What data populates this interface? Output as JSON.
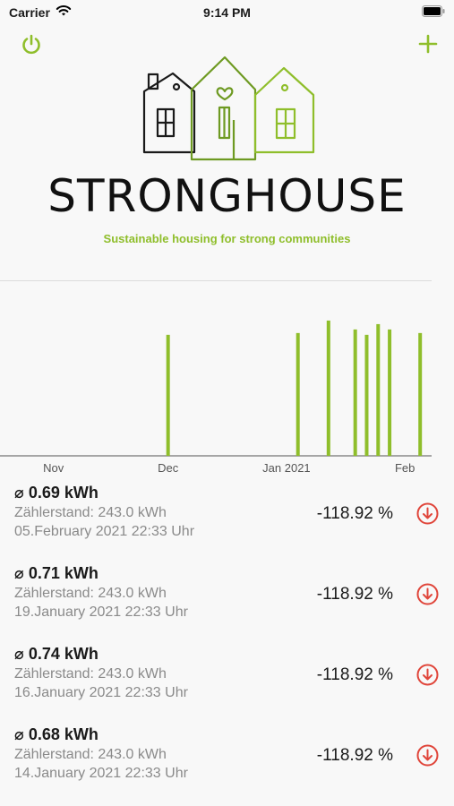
{
  "status_bar": {
    "carrier": "Carrier",
    "time": "9:14 PM"
  },
  "header": {
    "power_icon": "power-icon",
    "add_icon": "plus-icon"
  },
  "brand": {
    "name": "STRONGHOUSE",
    "tagline": "Sustainable housing for strong communities",
    "accent_color": "#8fbe2b",
    "dark_color": "#1a1a1a"
  },
  "chart_data": {
    "type": "bar",
    "x_tick_labels": [
      "Nov",
      "Dec",
      "Jan 2021",
      "Feb"
    ],
    "series": [
      {
        "values": [
          {
            "date": "2020-12-01",
            "value": 0.68
          },
          {
            "date": "2021-01-04",
            "value": 0.69
          },
          {
            "date": "2021-01-12",
            "value": 0.76
          },
          {
            "date": "2021-01-19",
            "value": 0.71
          },
          {
            "date": "2021-01-22",
            "value": 0.68
          },
          {
            "date": "2021-01-25",
            "value": 0.74
          },
          {
            "date": "2021-01-28",
            "value": 0.71
          },
          {
            "date": "2021-02-05",
            "value": 0.69
          }
        ]
      }
    ],
    "x_range": [
      "2020-10-18",
      "2021-02-08"
    ],
    "ylim": [
      0,
      0.8
    ],
    "grid": false,
    "bar_color": "#8fbe2b"
  },
  "readings": [
    {
      "avg": "⌀ 0.69 kWh",
      "meter": "Zählerstand: 243.0 kWh",
      "date": "05.February 2021  22:33 Uhr",
      "pct": "-118.92 %",
      "trend_icon": "arrow-down-circle-icon"
    },
    {
      "avg": "⌀ 0.71 kWh",
      "meter": "Zählerstand: 243.0 kWh",
      "date": "19.January 2021  22:33 Uhr",
      "pct": "-118.92 %",
      "trend_icon": "arrow-down-circle-icon"
    },
    {
      "avg": "⌀ 0.74 kWh",
      "meter": "Zählerstand: 243.0 kWh",
      "date": "16.January 2021  22:33 Uhr",
      "pct": "-118.92 %",
      "trend_icon": "arrow-down-circle-icon"
    },
    {
      "avg": "⌀ 0.68 kWh",
      "meter": "Zählerstand: 243.0 kWh",
      "date": "14.January 2021  22:33 Uhr",
      "pct": "-118.92 %",
      "trend_icon": "arrow-down-circle-icon"
    }
  ],
  "colors": {
    "down": "#e0453a",
    "muted_text": "#8a8a8a"
  }
}
